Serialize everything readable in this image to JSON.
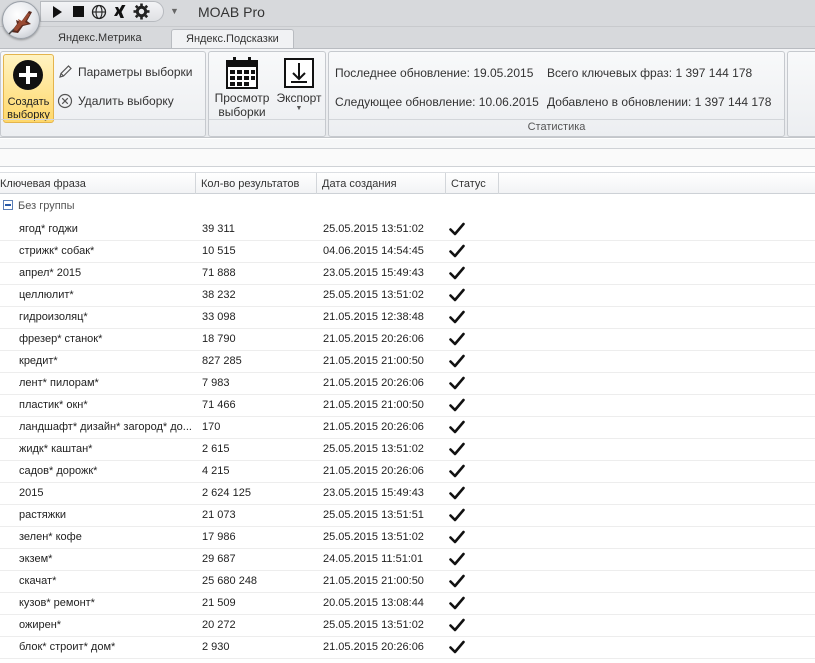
{
  "app": {
    "title": "MOAB Pro"
  },
  "tabs": [
    {
      "label": "Яндекс.Метрика"
    },
    {
      "label": "Яндекс.Подсказки"
    }
  ],
  "ribbon": {
    "create": {
      "line1": "Создать",
      "line2": "выборку"
    },
    "params_label": "Параметры выборки",
    "delete_label": "Удалить выборку",
    "view": {
      "line1": "Просмотр",
      "line2": "выборки"
    },
    "export_label": "Экспорт",
    "stats": {
      "last_update": "Последнее обновление: 19.05.2015",
      "total_phrases": "Всего ключевых фраз: 1 397 144 178",
      "next_update": "Следующее обновление: 10.06.2015",
      "added": "Добавлено в обновлении: 1 397 144 178",
      "group_label": "Статистика"
    }
  },
  "grid": {
    "columns": {
      "phrase": "Ключевая фраза",
      "count": "Кол-во результатов",
      "date": "Дата создания",
      "status": "Статус"
    },
    "group_label": "Без группы",
    "rows": [
      {
        "phrase": "ягод* годжи",
        "count": "39 311",
        "date": "25.05.2015 13:51:02"
      },
      {
        "phrase": "стрижк* собак*",
        "count": "10 515",
        "date": "04.06.2015 14:54:45"
      },
      {
        "phrase": "апрел* 2015",
        "count": "71 888",
        "date": "23.05.2015 15:49:43"
      },
      {
        "phrase": "целлюлит*",
        "count": "38 232",
        "date": "25.05.2015 13:51:02"
      },
      {
        "phrase": "гидроизоляц*",
        "count": "33 098",
        "date": "21.05.2015 12:38:48"
      },
      {
        "phrase": "фрезер* станок*",
        "count": "18 790",
        "date": "21.05.2015 20:26:06"
      },
      {
        "phrase": "кредит*",
        "count": "827 285",
        "date": "21.05.2015 21:00:50"
      },
      {
        "phrase": "лент* пилорам*",
        "count": "7 983",
        "date": "21.05.2015 20:26:06"
      },
      {
        "phrase": "пластик* окн*",
        "count": "71 466",
        "date": "21.05.2015 21:00:50"
      },
      {
        "phrase": "ландшафт* дизайн* загород* до...",
        "count": "170",
        "date": "21.05.2015 20:26:06"
      },
      {
        "phrase": "жидк* каштан*",
        "count": "2 615",
        "date": "25.05.2015 13:51:02"
      },
      {
        "phrase": "садов* дорожк*",
        "count": "4 215",
        "date": "21.05.2015 20:26:06"
      },
      {
        "phrase": "2015",
        "count": "2 624 125",
        "date": "23.05.2015 15:49:43"
      },
      {
        "phrase": "растяжки",
        "count": "21 073",
        "date": "25.05.2015 13:51:51"
      },
      {
        "phrase": "зелен* кофе",
        "count": "17 986",
        "date": "25.05.2015 13:51:02"
      },
      {
        "phrase": "экзем*",
        "count": "29 687",
        "date": "24.05.2015 11:51:01"
      },
      {
        "phrase": "скачат*",
        "count": "25 680 248",
        "date": "21.05.2015 21:00:50"
      },
      {
        "phrase": "кузов* ремонт*",
        "count": "21 509",
        "date": "20.05.2015 13:08:44"
      },
      {
        "phrase": "ожирен*",
        "count": "20 272",
        "date": "25.05.2015 13:51:02"
      },
      {
        "phrase": "блок* строит* дом*",
        "count": "2 930",
        "date": "21.05.2015 20:26:06"
      }
    ]
  }
}
